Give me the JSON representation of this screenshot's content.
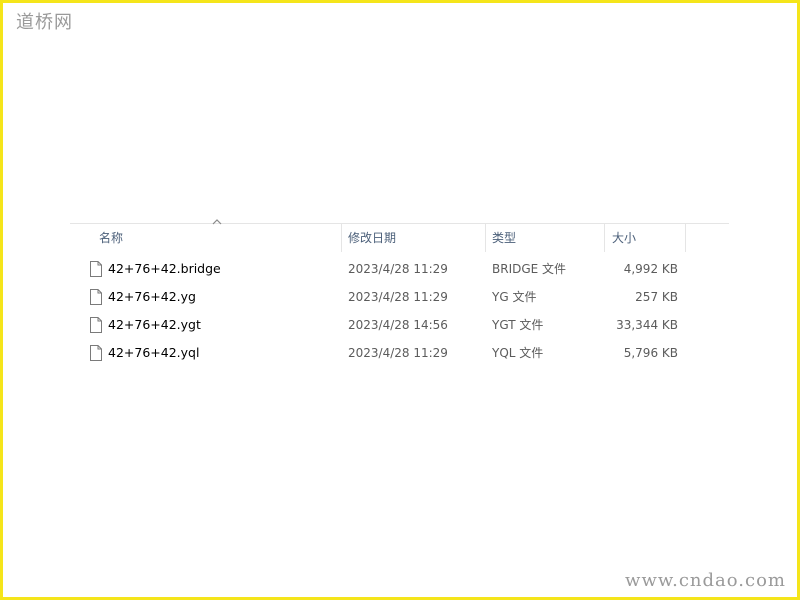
{
  "watermarks": {
    "top_left": "道桥网",
    "bottom_right": "www.cndao.com"
  },
  "columns": {
    "name": "名称",
    "date": "修改日期",
    "type": "类型",
    "size": "大小",
    "sorted_by": "name",
    "sort_direction": "ascending"
  },
  "files": [
    {
      "name": "42+76+42.bridge",
      "date": "2023/4/28 11:29",
      "type": "BRIDGE 文件",
      "size": "4,992 KB"
    },
    {
      "name": "42+76+42.yg",
      "date": "2023/4/28 11:29",
      "type": "YG 文件",
      "size": "257 KB"
    },
    {
      "name": "42+76+42.ygt",
      "date": "2023/4/28 14:56",
      "type": "YGT 文件",
      "size": "33,344 KB"
    },
    {
      "name": "42+76+42.yql",
      "date": "2023/4/28 11:29",
      "type": "YQL 文件",
      "size": "5,796 KB"
    }
  ],
  "icons": {
    "file": "file-icon",
    "sort": "sort-ascending-icon"
  },
  "colors": {
    "frame": "#f5e51a",
    "header_text": "#4c607a",
    "watermark": "#9a9a9a"
  }
}
